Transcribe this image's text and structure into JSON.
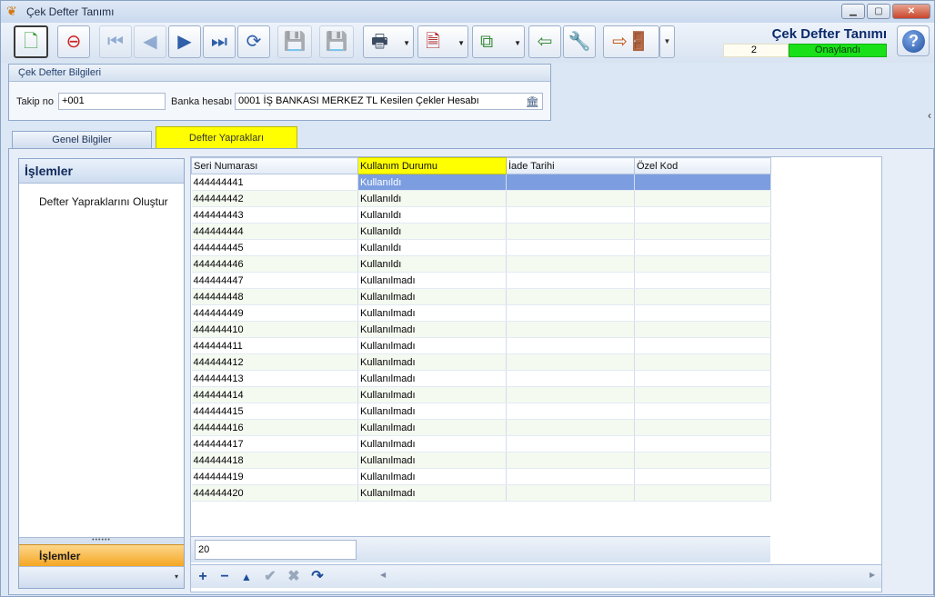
{
  "window": {
    "title": "Çek Defter Tanımı"
  },
  "header": {
    "title": "Çek Defter Tanımı",
    "record_no": "2",
    "status": "Onaylandı"
  },
  "group": {
    "title": "Çek Defter Bilgileri",
    "takip_label": "Takip no",
    "takip_value": "+001",
    "banka_label": "Banka hesabı",
    "banka_value": "0001 İŞ BANKASI MERKEZ TL Kesilen Çekler Hesabı"
  },
  "tabs": [
    {
      "label": "Genel Bilgiler"
    },
    {
      "label": "Defter Yaprakları"
    }
  ],
  "side": {
    "title": "İşlemler",
    "action": "Defter Yapraklarını Oluştur",
    "footer_tab": "İşlemler"
  },
  "grid": {
    "columns": [
      "Seri Numarası",
      "Kullanım Durumu",
      "İade Tarihi",
      "Özel Kod"
    ],
    "rows": [
      {
        "seri": "444444441",
        "durum": "Kullanıldı"
      },
      {
        "seri": "444444442",
        "durum": "Kullanıldı"
      },
      {
        "seri": "444444443",
        "durum": "Kullanıldı"
      },
      {
        "seri": "444444444",
        "durum": "Kullanıldı"
      },
      {
        "seri": "444444445",
        "durum": "Kullanıldı"
      },
      {
        "seri": "444444446",
        "durum": "Kullanıldı"
      },
      {
        "seri": "444444447",
        "durum": "Kullanılmadı"
      },
      {
        "seri": "444444448",
        "durum": "Kullanılmadı"
      },
      {
        "seri": "444444449",
        "durum": "Kullanılmadı"
      },
      {
        "seri": "444444410",
        "durum": "Kullanılmadı"
      },
      {
        "seri": "444444411",
        "durum": "Kullanılmadı"
      },
      {
        "seri": "444444412",
        "durum": "Kullanılmadı"
      },
      {
        "seri": "444444413",
        "durum": "Kullanılmadı"
      },
      {
        "seri": "444444414",
        "durum": "Kullanılmadı"
      },
      {
        "seri": "444444415",
        "durum": "Kullanılmadı"
      },
      {
        "seri": "444444416",
        "durum": "Kullanılmadı"
      },
      {
        "seri": "444444417",
        "durum": "Kullanılmadı"
      },
      {
        "seri": "444444418",
        "durum": "Kullanılmadı"
      },
      {
        "seri": "444444419",
        "durum": "Kullanılmadı"
      },
      {
        "seri": "444444420",
        "durum": "Kullanılmadı"
      }
    ],
    "row_count": "20"
  },
  "colors": {
    "accent": "#ffff00",
    "status": "#19e019",
    "selection": "#7c9ee0",
    "side_tab": "#f5a623"
  }
}
